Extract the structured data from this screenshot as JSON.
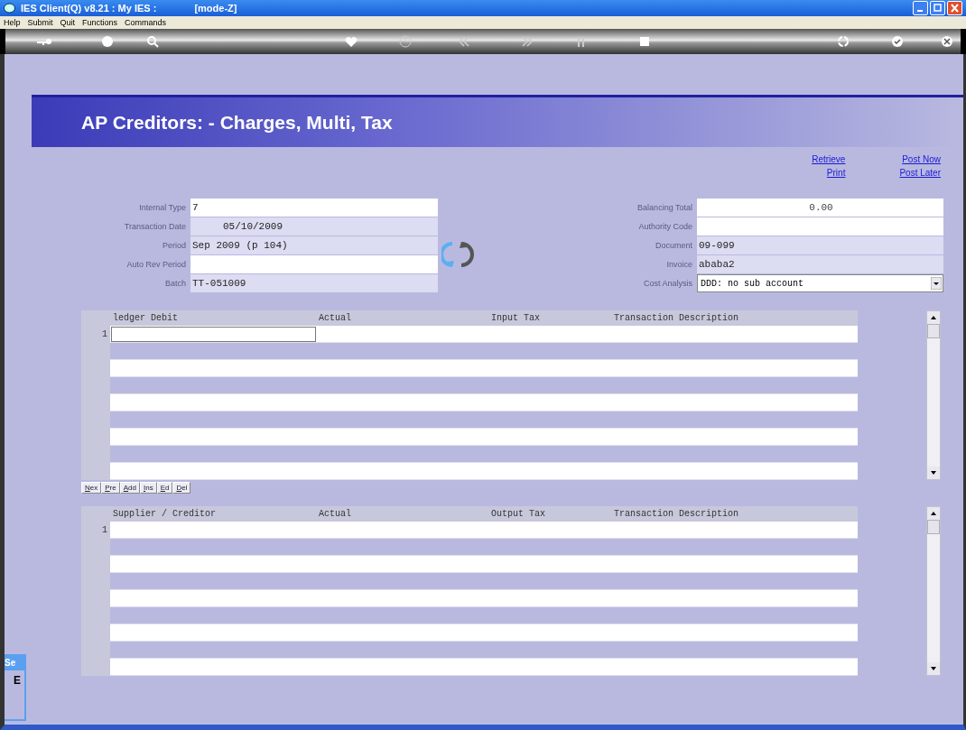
{
  "window": {
    "title": "IES Client(Q) v8.21 : My IES :",
    "mode": "[mode-Z]"
  },
  "menu": [
    "Help",
    "Submit",
    "Quit",
    "Functions",
    "Commands"
  ],
  "banner": {
    "title": "AP Creditors: - Charges, Multi, Tax"
  },
  "links": [
    {
      "label": "Retrieve"
    },
    {
      "label": "Post Now"
    },
    {
      "label": "Print"
    },
    {
      "label": "Post Later"
    }
  ],
  "form_left": [
    {
      "kind": "text",
      "label": "Internal Type",
      "value": "7",
      "editable": true
    },
    {
      "kind": "date",
      "label": "Transaction Date",
      "value": "05/10/2009",
      "editable": false
    },
    {
      "kind": "text",
      "label": "Period",
      "value": "Sep 2009 (p 104)",
      "editable": false
    },
    {
      "kind": "text",
      "label": "Auto Rev Period",
      "editable": true
    },
    {
      "kind": "text",
      "label": "Batch",
      "value": "TT-051009",
      "editable": false
    }
  ],
  "form_right": [
    {
      "kind": "amount",
      "label": "Balancing Total",
      "value": "0.00",
      "editable": true
    },
    {
      "kind": "text",
      "label": "Authority Code",
      "editable": true
    },
    {
      "kind": "text",
      "label": "Document",
      "value": "09-099",
      "editable": false
    },
    {
      "kind": "text",
      "label": "Invoice",
      "value": "ababa2",
      "editable": false
    },
    {
      "kind": "dropdown",
      "label": "Cost Analysis",
      "value": "DDD: no sub account"
    }
  ],
  "grids": [
    {
      "columns": [
        "ledger Debit",
        "Actual",
        "Input Tax",
        "Transaction Description"
      ],
      "rows": [
        {
          "number": "1",
          "focused": true
        }
      ],
      "buttons": [
        "Nex",
        "Pre",
        "Add",
        "Ins",
        "Ed",
        "Del"
      ]
    },
    {
      "columns": [
        "Supplier / Creditor",
        "Actual",
        "Output Tax",
        "Transaction Description"
      ],
      "rows": [
        {
          "number": "1",
          "focused": false
        }
      ]
    }
  ],
  "side_window": {
    "title": "Se",
    "text": "E"
  }
}
